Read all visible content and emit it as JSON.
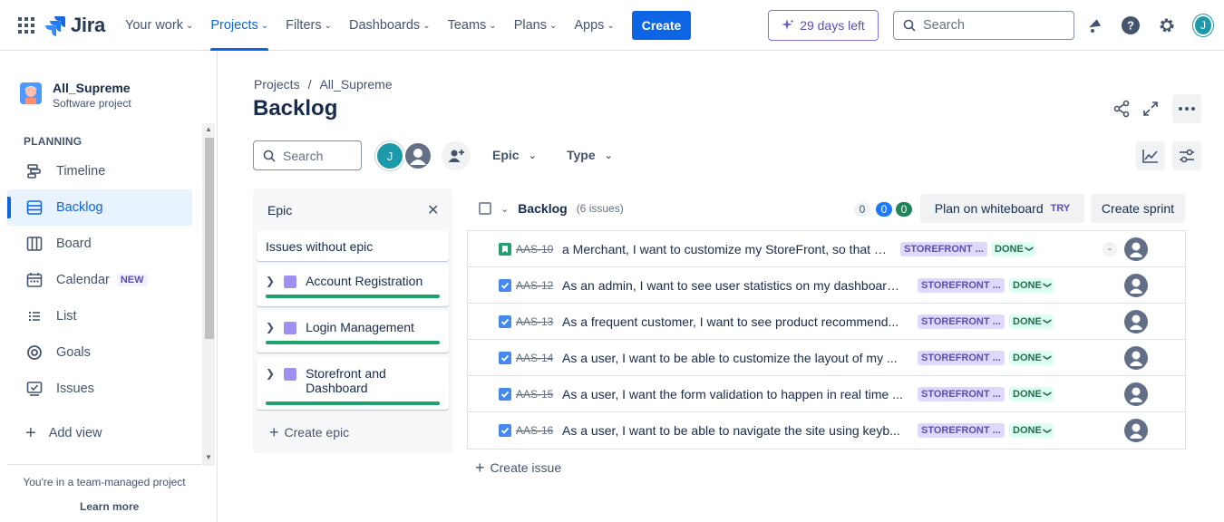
{
  "topnav": {
    "logo": "Jira",
    "items": [
      {
        "label": "Your work"
      },
      {
        "label": "Projects"
      },
      {
        "label": "Filters"
      },
      {
        "label": "Dashboards"
      },
      {
        "label": "Teams"
      },
      {
        "label": "Plans"
      },
      {
        "label": "Apps"
      }
    ],
    "create_label": "Create",
    "trial_label": "29 days left",
    "search_placeholder": "Search",
    "user_initial": "J"
  },
  "sidebar": {
    "project_name": "All_Supreme",
    "project_type": "Software project",
    "section": "PLANNING",
    "items": [
      {
        "label": "Timeline",
        "icon": "timeline-icon"
      },
      {
        "label": "Backlog",
        "icon": "backlog-icon"
      },
      {
        "label": "Board",
        "icon": "board-icon"
      },
      {
        "label": "Calendar",
        "icon": "calendar-icon",
        "badge": "NEW"
      },
      {
        "label": "List",
        "icon": "list-icon"
      },
      {
        "label": "Goals",
        "icon": "goals-icon"
      },
      {
        "label": "Issues",
        "icon": "issues-icon"
      }
    ],
    "add_view": "Add view",
    "team_note": "You're in a team-managed project",
    "learn_more": "Learn more"
  },
  "main": {
    "breadcrumb": [
      "Projects",
      "All_Supreme"
    ],
    "title": "Backlog",
    "search_placeholder": "Search",
    "avatar_initial": "J",
    "filters": [
      "Epic",
      "Type"
    ]
  },
  "epic_panel": {
    "title": "Epic",
    "no_epic": "Issues without epic",
    "epics": [
      {
        "name": "Account Registration",
        "progress": 1.0
      },
      {
        "name": "Login Management",
        "progress": 1.0
      },
      {
        "name": "Storefront and Dashboard",
        "progress": 1.0
      }
    ],
    "create_label": "Create epic"
  },
  "backlog": {
    "title": "Backlog",
    "count": "(6 issues)",
    "pills": [
      "0",
      "0",
      "0"
    ],
    "plan_label": "Plan on whiteboard",
    "try_label": "TRY",
    "sprint_label": "Create sprint",
    "issues": [
      {
        "key": "AAS-10",
        "type": "story",
        "summary": "a Merchant, I want to customize my StoreFront, so that I...",
        "epic": "STOREFRONT ...",
        "status": "DONE",
        "points": "-"
      },
      {
        "key": "AAS-12",
        "type": "task",
        "summary": "As an admin, I want to see user statistics on my dashboard,...",
        "epic": "STOREFRONT ...",
        "status": "DONE"
      },
      {
        "key": "AAS-13",
        "type": "task",
        "summary": "As a frequent customer, I want to see product recommend...",
        "epic": "STOREFRONT ...",
        "status": "DONE"
      },
      {
        "key": "AAS-14",
        "type": "task",
        "summary": "As a user, I want to be able to customize the layout of my ...",
        "epic": "STOREFRONT ...",
        "status": "DONE"
      },
      {
        "key": "AAS-15",
        "type": "task",
        "summary": "As a user, I want the form validation to happen in real time ...",
        "epic": "STOREFRONT ...",
        "status": "DONE"
      },
      {
        "key": "AAS-16",
        "type": "task",
        "summary": "As a user, I want to be able to navigate the site using keyb...",
        "epic": "STOREFRONT ...",
        "status": "DONE"
      }
    ],
    "create_issue": "Create issue"
  },
  "colors": {
    "brand": "#0c66e4",
    "epic": "#9f8fef",
    "done": "#22a06b",
    "story": "#22a06b",
    "task": "#4688ec"
  }
}
